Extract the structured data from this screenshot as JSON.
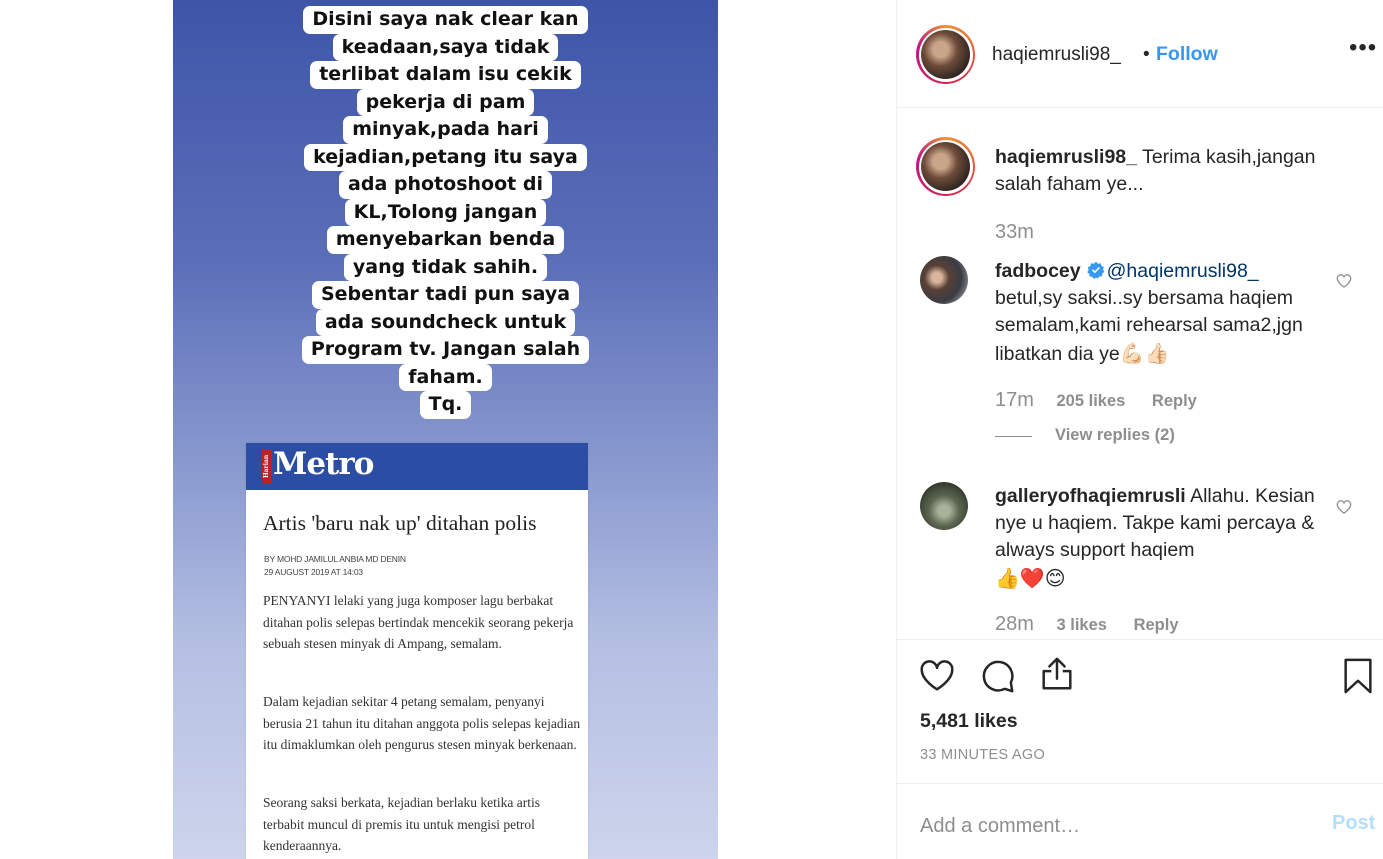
{
  "post": {
    "story_lines": [
      "Disini saya nak clear kan",
      "keadaan,saya tidak",
      "terlibat dalam isu cekik",
      "pekerja di pam",
      "minyak,pada hari",
      "kejadian,petang itu saya",
      "ada photoshoot di",
      "KL,Tolong jangan",
      "menyebarkan benda",
      "yang tidak sahih.",
      "Sebentar tadi pun saya",
      "ada soundcheck untuk",
      "Program tv. Jangan salah",
      "faham.",
      "Tq."
    ],
    "article": {
      "brand_small": "Harian",
      "brand": "Metro",
      "title": "Artis 'baru nak up' ditahan polis",
      "byline": "BY MOHD JAMILUL ANBIA MD DENIN",
      "date": "29 AUGUST 2019 AT 14:03",
      "paragraphs": [
        "PENYANYI lelaki yang juga komposer lagu berbakat ditahan polis selepas bertindak mencekik seorang pekerja sebuah stesen minyak di Ampang, semalam.",
        "Dalam kejadian sekitar 4 petang semalam, penyanyi berusia 21 tahun itu ditahan anggota polis selepas kejadian itu dimaklumkan oleh pengurus stesen minyak berkenaan.",
        "Seorang saksi berkata, kejadian berlaku ketika artis terbabit muncul di premis itu untuk mengisi petrol kenderaannya."
      ]
    }
  },
  "header": {
    "username": "haqiemrusli98_",
    "separator": "•",
    "follow_label": "Follow",
    "more_label": "•••"
  },
  "comments": [
    {
      "username": "haqiemrusli98_",
      "text": "Terima kasih,jangan salah faham ye...",
      "age": "33m"
    },
    {
      "username": "fadbocey",
      "mention": "@haqiemrusli98_",
      "text": "betul,sy saksi..sy bersama haqiem semalam,kami rehearsal sama2,jgn libatkan dia ye",
      "emoji": "💪🏻👍🏻",
      "age": "17m",
      "likes": "205 likes",
      "reply": "Reply",
      "view_replies": "View replies (2)"
    },
    {
      "username": "galleryofhaqiemrusli",
      "text": "Allahu. Kesian nye u haqiem. Takpe kami percaya & always support haqiem",
      "emoji": "👍❤️😊",
      "age": "28m",
      "likes": "3 likes",
      "reply": "Reply"
    }
  ],
  "actions": {
    "likes": "5,481 likes",
    "time_ago": "33 MINUTES AGO",
    "comment_placeholder": "Add a comment…",
    "post_label": "Post"
  },
  "colors": {
    "link_blue": "#3897f0",
    "post_disabled": "#b2dffc",
    "metro_blue": "#2b4da3"
  }
}
